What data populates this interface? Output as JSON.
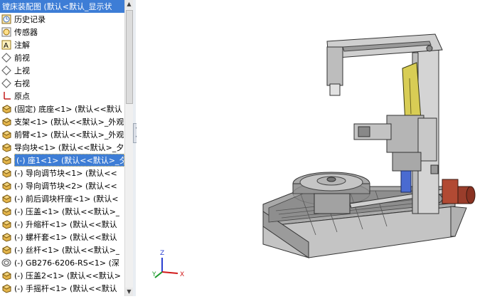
{
  "tree": {
    "root_label": "镗床装配图  (默认<默认_显示状",
    "items": [
      {
        "label": "历史记录",
        "icon": "history-icon"
      },
      {
        "label": "传感器",
        "icon": "sensor-icon"
      },
      {
        "label": "注解",
        "icon": "annotation-icon"
      },
      {
        "label": "前视",
        "icon": "plane-icon"
      },
      {
        "label": "上视",
        "icon": "plane-icon"
      },
      {
        "label": "右视",
        "icon": "plane-icon"
      },
      {
        "label": "原点",
        "icon": "origin-icon"
      },
      {
        "label": "(固定) 底座<1> (默认<<默认",
        "icon": "part-icon"
      },
      {
        "label": "支架<1> (默认<<默认>_外观",
        "icon": "part-icon"
      },
      {
        "label": "前臂<1> (默认<<默认>_外观",
        "icon": "part-icon"
      },
      {
        "label": "导向块<1> (默认<<默认>_夕",
        "icon": "part-icon"
      },
      {
        "label": "(-) 座1<1> (默认<<默认>_夕",
        "icon": "part-icon",
        "selected": true
      },
      {
        "label": "(-) 导向调节块<1> (默认<<",
        "icon": "part-icon"
      },
      {
        "label": "(-) 导向调节块<2> (默认<<",
        "icon": "part-icon"
      },
      {
        "label": "(-) 前后调块杆座<1> (默认<",
        "icon": "part-icon"
      },
      {
        "label": "(-) 压盖<1> (默认<<默认>_",
        "icon": "part-icon"
      },
      {
        "label": "(-) 升缩杆<1> (默认<<默认",
        "icon": "part-icon"
      },
      {
        "label": "(-) 螺杆套<1> (默认<<默认",
        "icon": "part-icon"
      },
      {
        "label": "(-) 丝杆<1> (默认<<默认>_",
        "icon": "part-icon"
      },
      {
        "label": "(-) GB276-6206-RS<1> (深",
        "icon": "bearing-icon"
      },
      {
        "label": "(-) 压盖2<1> (默认<<默认>",
        "icon": "part-icon"
      },
      {
        "label": "(-) 手摇杆<1> (默认<<默认",
        "icon": "part-icon"
      }
    ]
  },
  "triad": {
    "x": "X",
    "y": "Y",
    "z": "Z"
  },
  "colors": {
    "selection": "#3d7dd6",
    "part_gray": "#b8b8b8",
    "plate_yellow": "#d8cd55",
    "motor_red": "#b24a33"
  }
}
